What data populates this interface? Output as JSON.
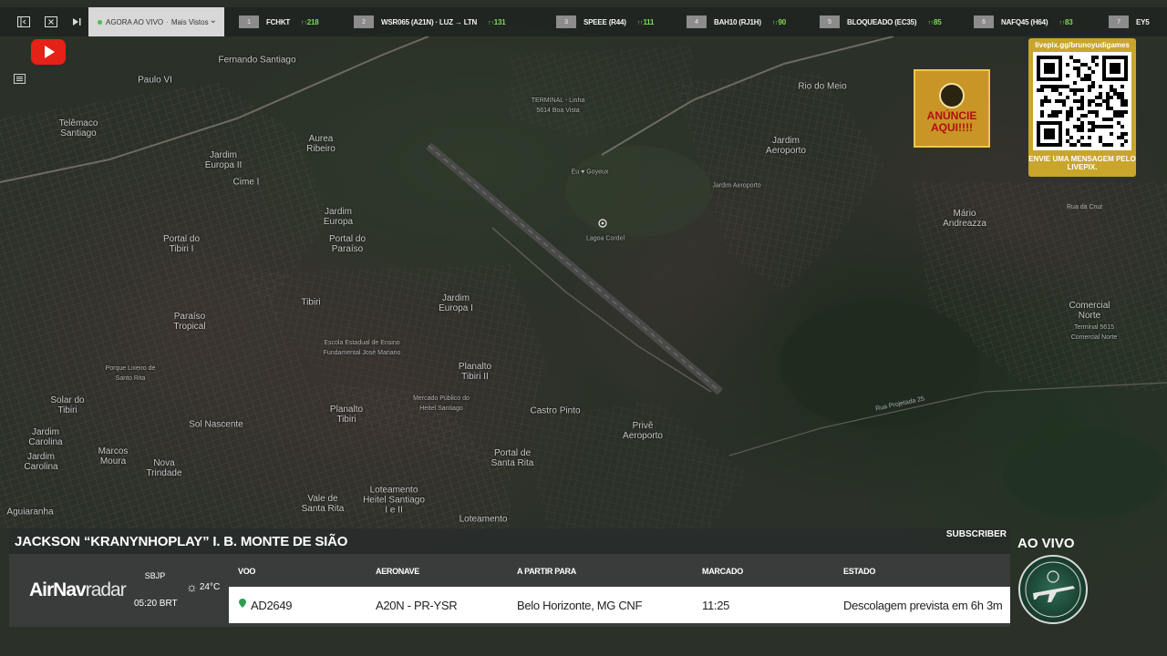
{
  "topbar": {
    "dropdown": {
      "status": "AGORA AO VIVO",
      "separator": "·",
      "value": "Mais Vistos"
    },
    "flights": [
      {
        "rank": "1",
        "callsign": "FCHKT",
        "views": "218"
      },
      {
        "rank": "2",
        "callsign": "WSR065 (A21N) · LUZ → LTN",
        "views": "131"
      },
      {
        "rank": "3",
        "callsign": "SPEEE (R44)",
        "views": "111"
      },
      {
        "rank": "4",
        "callsign": "BAH10 (RJ1H)",
        "views": "90"
      },
      {
        "rank": "5",
        "callsign": "BLOQUEADO (EC35)",
        "views": "85"
      },
      {
        "rank": "6",
        "callsign": "NAFQ45 (H64)",
        "views": "83"
      },
      {
        "rank": "7",
        "callsign": "EY5",
        "views": ""
      }
    ]
  },
  "ad": {
    "text": "ANÚNCIE AQUI!!!!"
  },
  "qr": {
    "url": "livepix.gg/brunoyudigames",
    "caption": "ENVIE UMA MENSAGEM PELO LIVEPIX."
  },
  "map_labels": {
    "fernando_santiago": "Fernando Santiago",
    "paulo_vi": "Paulo VI",
    "telemaco": "Telêmaco Santiago",
    "aurea_ribeiro": "Aurea Ribeiro",
    "jardim_europa_ii": "Jardim Europa II",
    "cime_i": "Cime I",
    "jardim_europa": "Jardim Europa",
    "portal_tibiri": "Portal do Tibiri I",
    "portal_paraiso": "Portal do Paraíso",
    "terminal_linha": "TERMINAL - Linha 5614 Boa Vista",
    "eu_amo": "Eu ♥ Goyeux",
    "lagoa_cordel": "Lagoa Cordel",
    "rio_do_meio": "Rio do Meio",
    "jardim_aeroporto_1": "Jardim Aeroporto",
    "jardim_aeroporto_2": "Jardim Aeroporto",
    "mario_andreazza": "Mário Andreazza",
    "tibiri": "Tibiri",
    "jardim_europa_i": "Jardim Europa I",
    "paraiso_tropical": "Paraíso Tropical",
    "porque_lixeiro": "Porque Lixeiro de Santo Rita",
    "escola": "Escola Estadual de Ensino Fundamental José Mariano",
    "planalto_tibiri_ii": "Planalto Tibiri II",
    "solar_tibiri": "Solar do Tibiri",
    "planalto_tibiri": "Planalto Tibiri",
    "mercado": "Mercado Público do Heitel Santiago",
    "castro_pinto": "Castro Pinto",
    "prive_aeroporto": "Privê Aeroporto",
    "comercial_norte": "Comercial Norte",
    "terminal_comercial": "Terminal 5615 Comercial Norte",
    "jardim_carolina": "Jardim Carolina",
    "marcos_moura": "Marcos Moura",
    "jardim_carolina_2": "Jardim Carolina",
    "sol_nascente": "Sol Nascente",
    "nova_trindade": "Nova Trindade",
    "portal_santa_rita": "Portal de Santa Rita",
    "vale_santa_rita": "Vale de Santa Rita",
    "loteamento_heitel": "Loteamento Heitel Santiago I e II",
    "loteamento": "Loteamento",
    "aguiaranha": "Aguiaranha",
    "rua_projetada": "Rua Projetada 25",
    "rua_cruz": "Rua da Cruz"
  },
  "panel": {
    "name": "JACKSON “KRANYNHOPLAY” I. B. MONTE DE SIÃO",
    "subscriber": "SUBSCRIBER",
    "brand_bold": "AirNav",
    "brand_light": "radar",
    "airport": "SBJP",
    "time": "05:20 BRT",
    "temperature": "24°C",
    "headers": {
      "flight": "VOO",
      "aircraft": "AERONAVE",
      "route": "A PARTIR PARA",
      "scheduled": "MARCADO",
      "status": "ESTADO"
    },
    "row": {
      "flight": "AD2649",
      "aircraft": "A20N - PR-YSR",
      "route": "Belo Horizonte, MG CNF",
      "scheduled": "11:25",
      "status": "Descolagem prevista em 6h 3m"
    }
  },
  "live": {
    "label": "AO VIVO"
  },
  "colors": {
    "views_green": "#7ed957",
    "youtube_red": "#e62117",
    "qr_gold": "#c9a52c"
  }
}
